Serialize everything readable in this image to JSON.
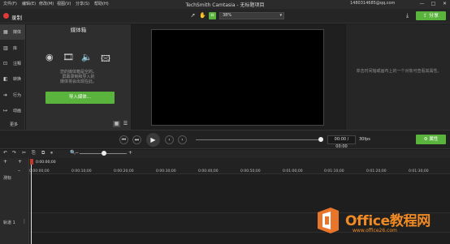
{
  "menu": [
    "文件(F)",
    "编辑(E)",
    "修改(M)",
    "视图(V)",
    "分享(S)",
    "帮助(H)"
  ],
  "window_title": "TechSmith Camtasia - 无标题项目",
  "user_email": "1480314685@qq.com",
  "window_buttons": {
    "minimize": "—",
    "maximize": "□",
    "close": "✕"
  },
  "toolbar": {
    "record_label": "录制",
    "zoom_value": "38%",
    "share_label": "分享",
    "tool_icons": [
      "pointer-icon",
      "hand-icon",
      "crop-icon"
    ]
  },
  "rail": {
    "items": [
      {
        "icon": "▦",
        "label": "媒体"
      },
      {
        "icon": "▥",
        "label": "库"
      },
      {
        "icon": "⊡",
        "label": "注释"
      },
      {
        "icon": "◧",
        "label": "转换"
      },
      {
        "icon": "➔",
        "label": "行为"
      },
      {
        "icon": "↦",
        "label": "动画"
      }
    ],
    "more_label": "更多",
    "add_symbol": "+"
  },
  "bin": {
    "title": "媒体箱",
    "empty_lines": [
      "您的媒体箱是空的。",
      "屏幕录制和导入的",
      "媒体将会出现在此。"
    ],
    "import_label": "导入媒体..."
  },
  "properties_hint": "单击时间轴或画布上的一个对象可查看其属性。",
  "playback": {
    "time": "00:00 / 00:00",
    "fps": "30fps",
    "properties_label": "属性"
  },
  "timeline": {
    "playhead_time": "0:00:00;00",
    "ticks": [
      "0:00:00;00",
      "0:00:10;00",
      "0:00:20;00",
      "0:00:30;00",
      "0:00:40;00",
      "0:00:50;00",
      "0:01:00;00",
      "0:01:10;00",
      "0:01:20;00",
      "0:01:30;00"
    ],
    "tracks": [
      {
        "label": "轨道 1"
      }
    ],
    "marker_label": "测标"
  },
  "watermark": {
    "brand": "Office教程网",
    "site": "www.office26.com"
  },
  "colors": {
    "accent": "#59b33c",
    "record": "#e23a3a",
    "watermark": "#f08a24"
  }
}
